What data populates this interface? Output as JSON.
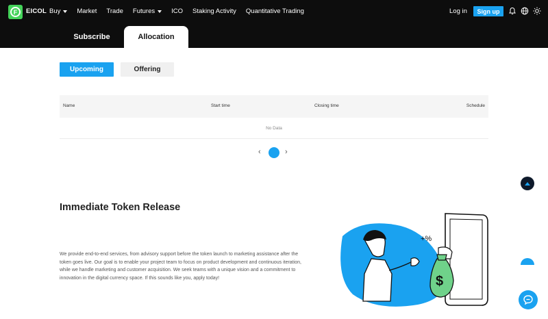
{
  "header": {
    "brand": "EICOL",
    "nav": [
      {
        "label": "Buy",
        "dropdown": true
      },
      {
        "label": "Market",
        "dropdown": false
      },
      {
        "label": "Trade",
        "dropdown": false
      },
      {
        "label": "Futures",
        "dropdown": true
      },
      {
        "label": "ICO",
        "dropdown": false
      },
      {
        "label": "Staking Activity",
        "dropdown": false
      },
      {
        "label": "Quantitative Trading",
        "dropdown": false
      }
    ],
    "login": "Log in",
    "signup": "Sign up",
    "icons": [
      "bell-icon",
      "globe-icon",
      "sun-icon"
    ]
  },
  "tabs": {
    "subscribe": "Subscribe",
    "allocation": "Allocation"
  },
  "filters": {
    "upcoming": "Upcoming",
    "offering": "Offering"
  },
  "table": {
    "columns": [
      "Name",
      "Start time",
      "Closing time",
      "Schedule"
    ],
    "empty": "No Data"
  },
  "pagination": {
    "prev": "‹",
    "next": "›"
  },
  "section": {
    "title": "Immediate Token Release",
    "body": "We provide end-to-end services, from advisory support before the token launch to marketing assistance after the token goes live. Our goal is to enable your project team to focus on product development and continuous iteration, while we handle marketing and customer acquisition. We seek teams with a unique vision and a commitment to innovation in the digital currency space. If this sounds like you, apply today!"
  },
  "colors": {
    "accent": "#1aa2f0",
    "header_bg": "#0d0d0d",
    "logo": "#44d35a",
    "money_bag": "#6fd28a"
  }
}
